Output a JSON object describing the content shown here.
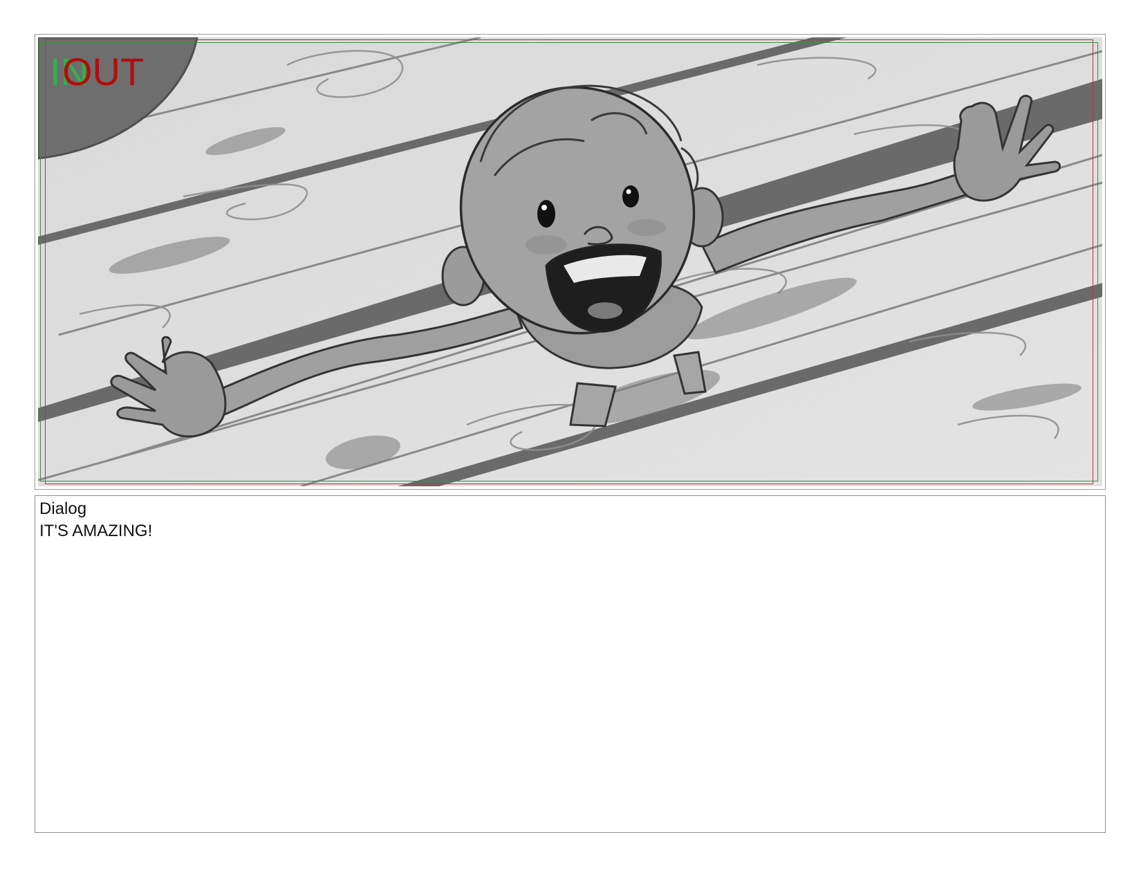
{
  "panel": {
    "marker_in": "IN",
    "marker_out": "OUT",
    "colors": {
      "in_marker": "#2db84a",
      "out_marker": "#b40d0d",
      "safe_red": "#b0383a",
      "safe_green": "#3e8e41"
    }
  },
  "dialog": {
    "heading": "Dialog",
    "text": "IT'S AMAZING!"
  }
}
